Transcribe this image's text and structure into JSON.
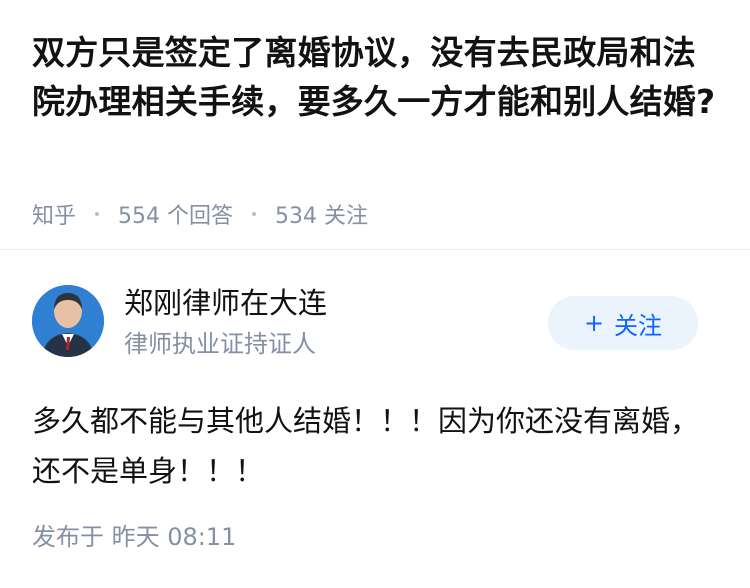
{
  "question": {
    "title": "双方只是签定了离婚协议，没有去民政局和法院办理相关手续，要多久一方才能和别人结婚?",
    "source": "知乎",
    "answer_count": "554 个回答",
    "follower_count": "534 关注"
  },
  "answer": {
    "author": {
      "name": "郑刚律师在大连",
      "description": "律师执业证持证人",
      "follow_label": "关注",
      "follow_icon": "plus-icon"
    },
    "content": "多久都不能与其他人结婚！！！因为你还没有离婚，还不是单身！！！",
    "published": "发布于  昨天 08:11"
  },
  "colors": {
    "title": "#121212",
    "meta": "#8590a6",
    "follow_text": "#0c66ff",
    "follow_bg": "#ebf3fd",
    "divider": "#ececec"
  }
}
